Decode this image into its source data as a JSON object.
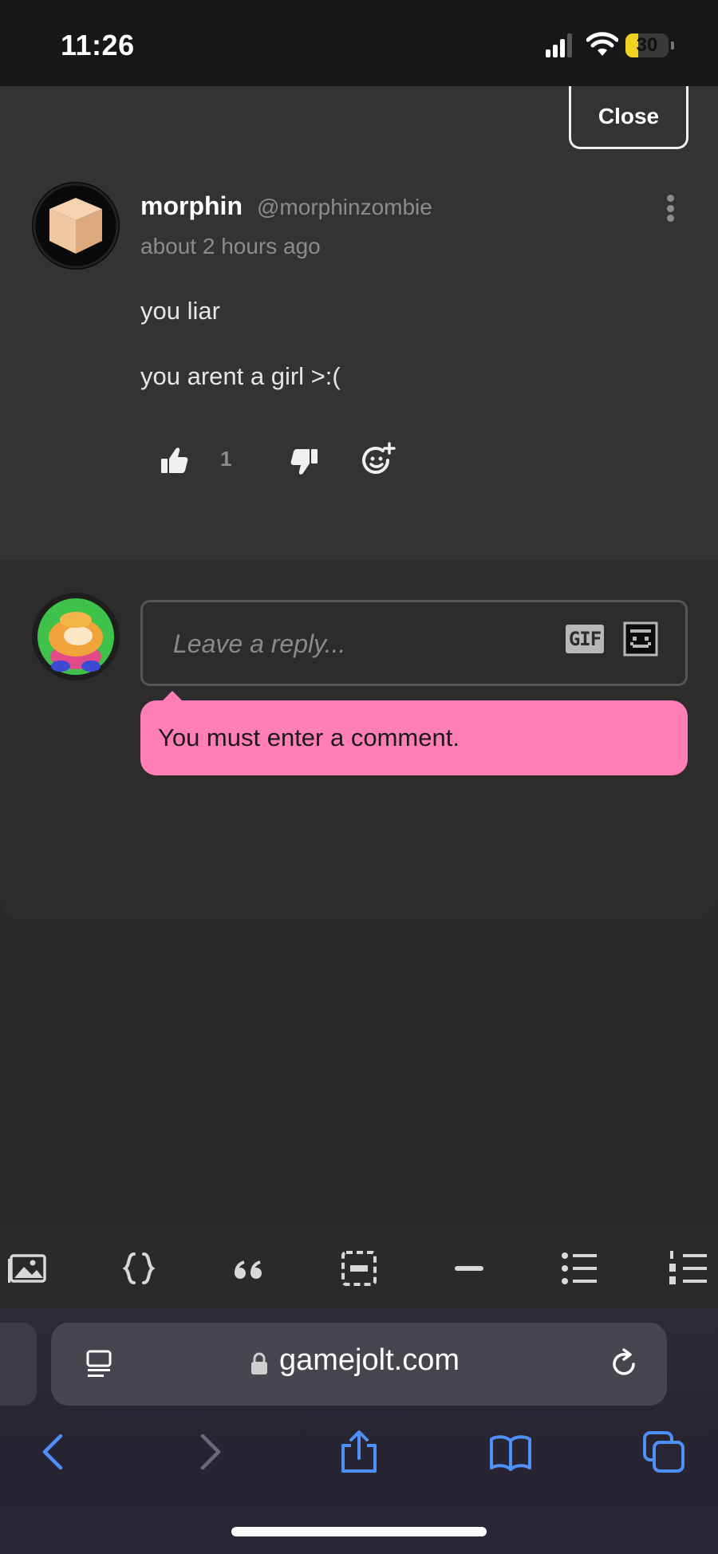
{
  "status_bar": {
    "time": "11:26",
    "battery_level": "30",
    "battery_fraction": 0.3,
    "battery_color": "#f2d21e",
    "icons": [
      "signal-icon",
      "wifi-icon",
      "battery-icon"
    ]
  },
  "modal": {
    "close_label": "Close"
  },
  "comment": {
    "author_name": "morphin",
    "author_handle": "@morphinzombie",
    "timestamp": "about 2 hours ago",
    "lines": [
      "you liar",
      "you arent a girl >:("
    ],
    "like_count": "1",
    "actions": [
      "thumbs-up-icon",
      "thumbs-down-icon",
      "add-reaction-icon",
      "more-vertical-icon"
    ]
  },
  "reply": {
    "placeholder": "Leave a reply...",
    "gif_label": "GIF",
    "error_message": "You must enter a comment.",
    "error_color": "#ff7eb3"
  },
  "editor_toolbar": {
    "tools": [
      "image-icon",
      "code-braces-icon",
      "quote-icon",
      "spoiler-icon",
      "horizontal-rule-icon",
      "bulleted-list-icon",
      "numbered-list-icon"
    ]
  },
  "browser": {
    "url": "gamejolt.com",
    "nav": [
      "back-icon",
      "forward-icon",
      "share-icon",
      "bookmarks-icon",
      "tabs-icon"
    ],
    "accent": "#4f8ff7"
  }
}
